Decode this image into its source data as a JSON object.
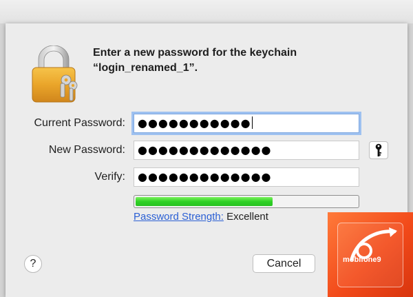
{
  "dialog": {
    "title_line1": "Enter a new password for the keychain",
    "title_line2": "“login_renamed_1”."
  },
  "fields": {
    "current_label": "Current Password:",
    "current_value": "●●●●●●●●●●●",
    "new_label": "New Password:",
    "new_value": "●●●●●●●●●●●●●",
    "verify_label": "Verify:",
    "verify_value": "●●●●●●●●●●●●●"
  },
  "strength": {
    "link_label": "Password Strength:",
    "value": "Excellent",
    "level_fraction": 0.61,
    "color": "#2fd126"
  },
  "buttons": {
    "help_label": "?",
    "cancel_label": "Cancel",
    "key_icon": "key-icon"
  },
  "watermark": {
    "text": "mobifone9"
  }
}
